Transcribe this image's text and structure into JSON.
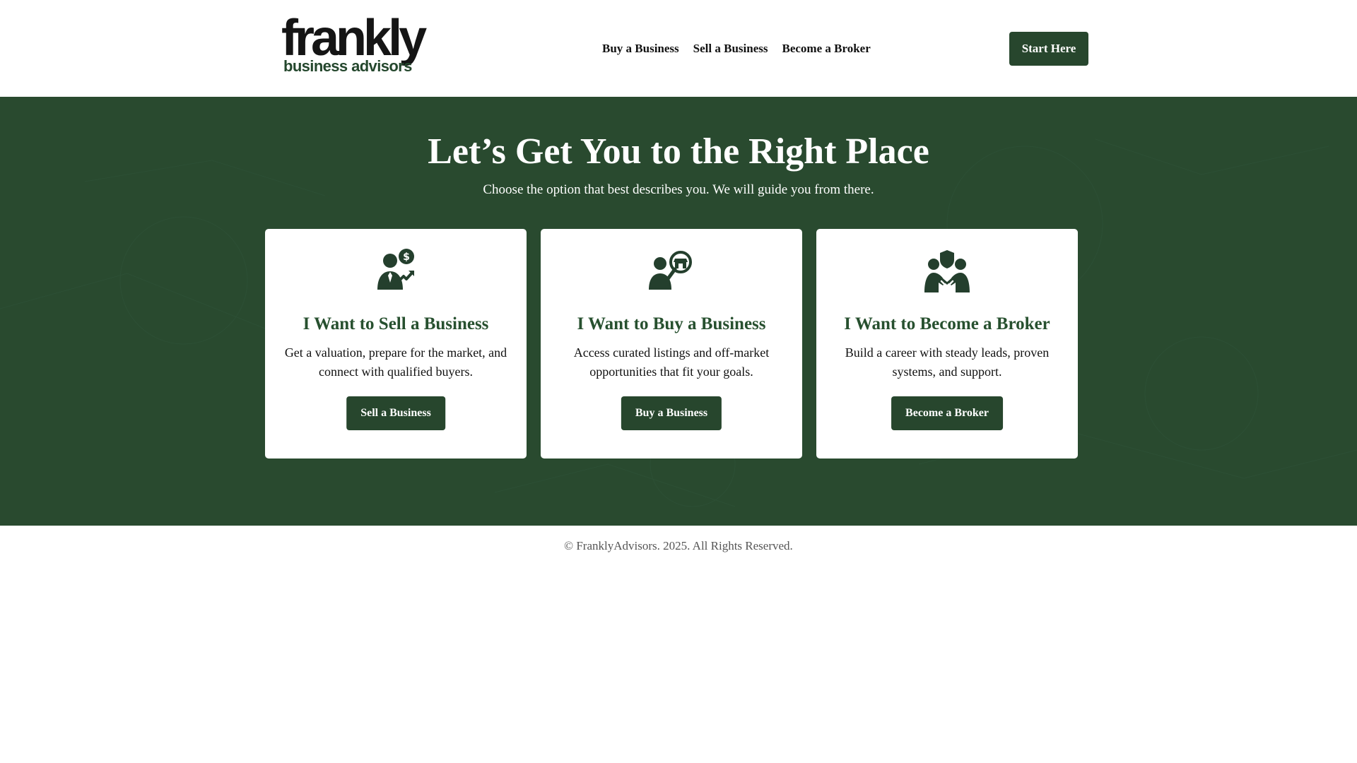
{
  "brand": {
    "wordmark": "frankly",
    "tagline": "business advisors",
    "primary_color": "#294a2f",
    "button_color": "#27462d",
    "title_color": "#27502f"
  },
  "nav": {
    "items": [
      {
        "label": "Buy a Business"
      },
      {
        "label": "Sell a Business"
      },
      {
        "label": "Become a Broker"
      }
    ],
    "cta_label": "Start Here"
  },
  "hero": {
    "title": "Let’s Get You to the Right Place",
    "subtitle": "Choose the option that best describes you. We will guide you from there."
  },
  "cards": [
    {
      "icon": "seller-dollar-growth-icon",
      "title": "I Want to Sell a Business",
      "text": "Get a valuation, prepare for the market, and connect with qualified buyers.",
      "button": "Sell a Business"
    },
    {
      "icon": "buyer-search-store-icon",
      "title": "I Want to Buy a Business",
      "text": "Access curated listings and off-market opportunities that fit your goals.",
      "button": "Buy a Business"
    },
    {
      "icon": "broker-handshake-icon",
      "title": "I Want to Become a Broker",
      "text": "Build a career with steady leads, proven systems, and support.",
      "button": "Become a Broker"
    }
  ],
  "footer": {
    "copyright": "© FranklyAdvisors. 2025. All Rights Reserved."
  }
}
